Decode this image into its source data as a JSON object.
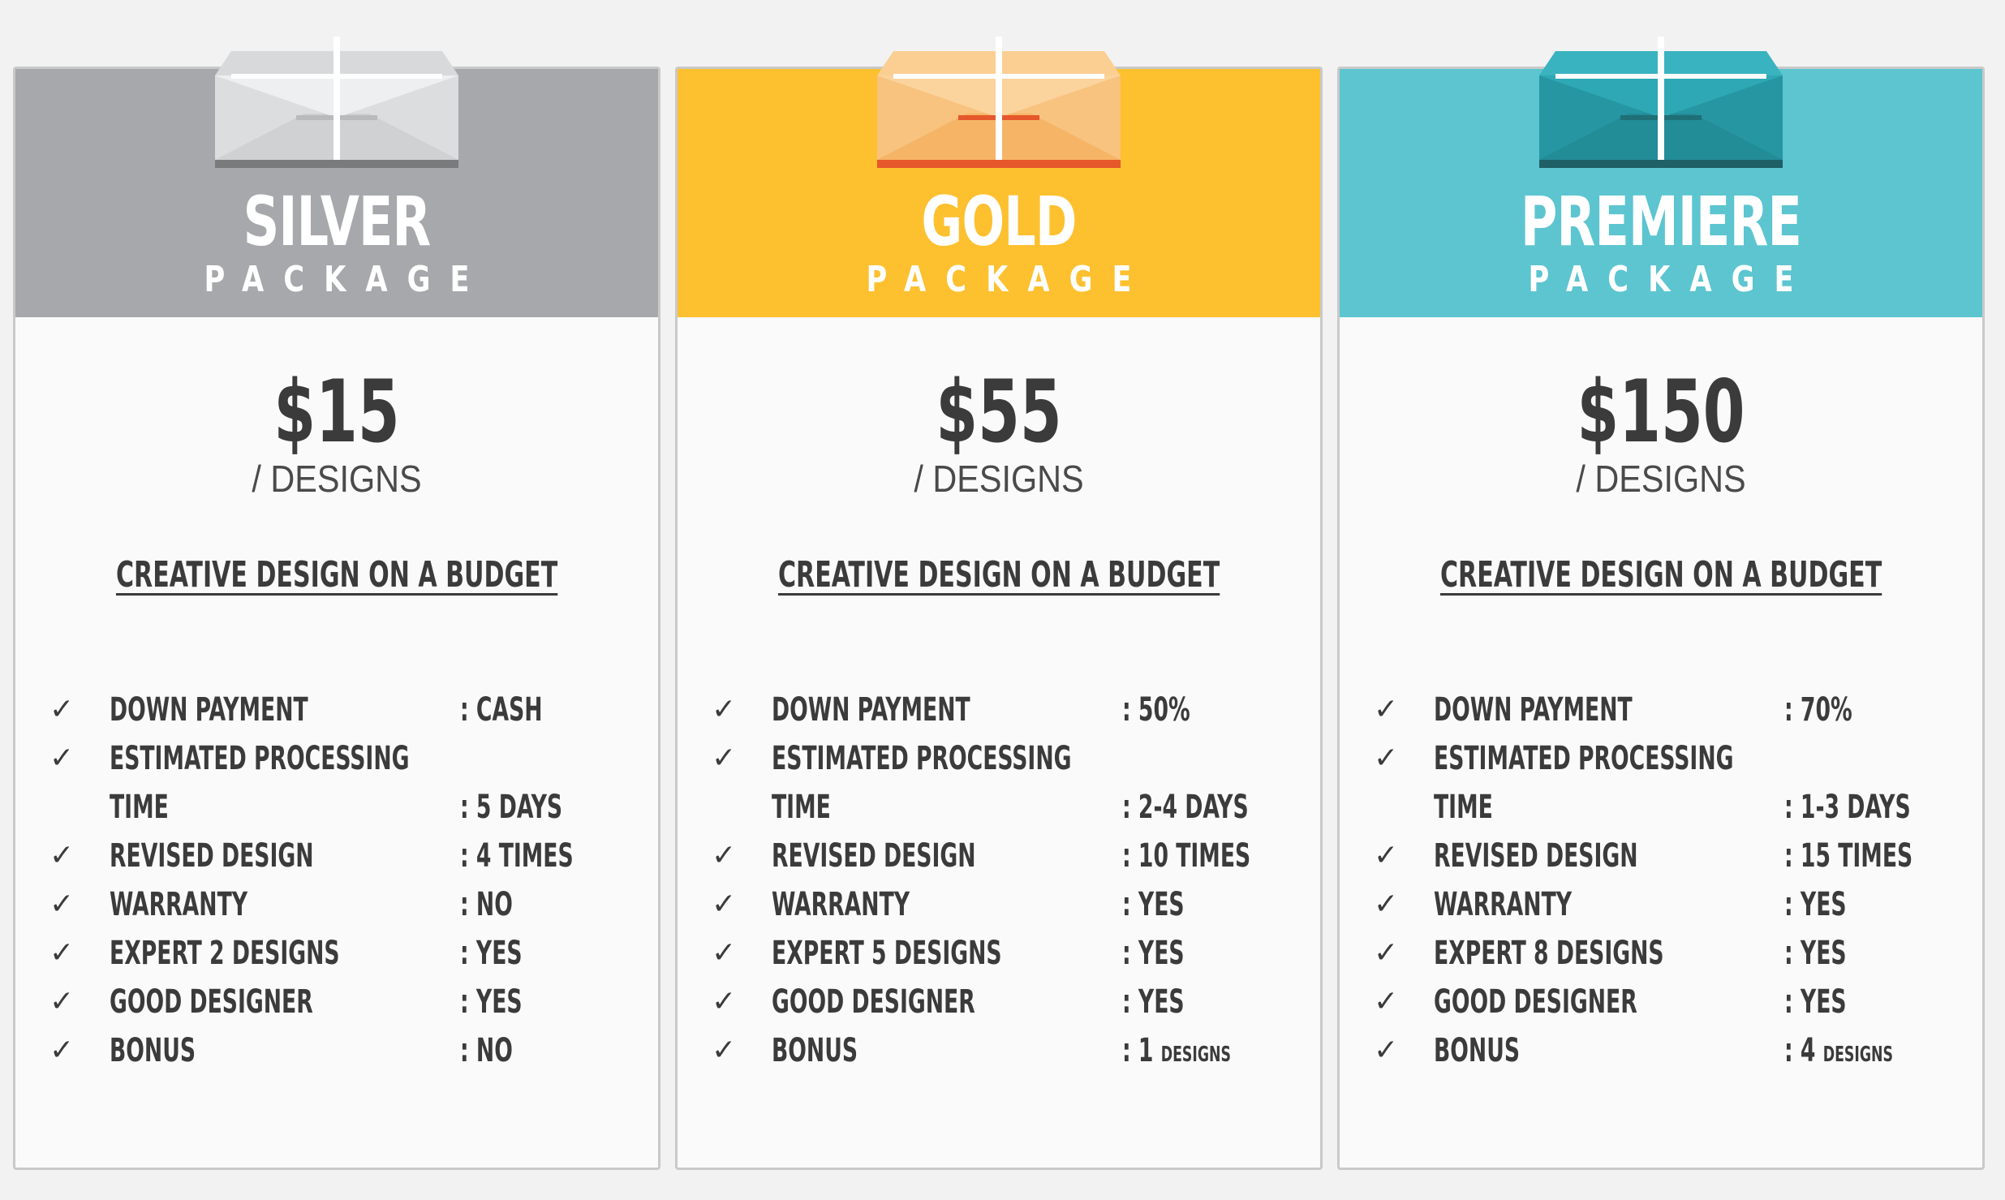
{
  "packages": [
    {
      "name": "SILVER",
      "subtitle": "PACKAGE",
      "price": "$15",
      "unit": "/ DESIGNS",
      "tagline": "CREATIVE DESIGN ON A BUDGET",
      "header_color": "#a7a8ab",
      "features": [
        {
          "label": "DOWN PAYMENT",
          "value": ": CASH",
          "check": "✓"
        },
        {
          "label": "ESTIMATED PROCESSING",
          "value": "",
          "check": "✓"
        },
        {
          "label": "TIME",
          "value": ": 5 DAYS",
          "check": ""
        },
        {
          "label": "REVISED DESIGN",
          "value": ": 4 TIMES",
          "check": "✓"
        },
        {
          "label": "WARRANTY",
          "value": ": NO",
          "check": "✓"
        },
        {
          "label": "EXPERT 2 DESIGNS",
          "value": ": YES",
          "check": "✓"
        },
        {
          "label": "GOOD DESIGNER",
          "value": ": YES",
          "check": "✓"
        },
        {
          "label": "BONUS",
          "value": ": NO",
          "check": "✓"
        }
      ]
    },
    {
      "name": "GOLD",
      "subtitle": "PACKAGE",
      "price": "$55",
      "unit": "/ DESIGNS",
      "tagline": "CREATIVE DESIGN ON A BUDGET",
      "header_color": "#fdc02f",
      "features": [
        {
          "label": "DOWN PAYMENT",
          "value": ": 50%",
          "check": "✓"
        },
        {
          "label": "ESTIMATED PROCESSING",
          "value": "",
          "check": "✓"
        },
        {
          "label": "TIME",
          "value": ": 2-4 DAYS",
          "check": ""
        },
        {
          "label": "REVISED DESIGN",
          "value": ": 10 TIMES",
          "check": "✓"
        },
        {
          "label": "WARRANTY",
          "value": ": YES",
          "check": "✓"
        },
        {
          "label": "EXPERT 5 DESIGNS",
          "value": ": YES",
          "check": "✓"
        },
        {
          "label": "GOOD DESIGNER",
          "value": ": YES",
          "check": "✓"
        },
        {
          "label": "BONUS",
          "value": ": 1",
          "suffix": "DESIGNS",
          "check": "✓"
        }
      ]
    },
    {
      "name": "PREMIERE",
      "subtitle": "PACKAGE",
      "price": "$150",
      "unit": "/ DESIGNS",
      "tagline": "CREATIVE DESIGN ON A BUDGET",
      "header_color": "#5cc5d0",
      "features": [
        {
          "label": "DOWN PAYMENT",
          "value": ": 70%",
          "check": "✓"
        },
        {
          "label": "ESTIMATED PROCESSING",
          "value": "",
          "check": "✓"
        },
        {
          "label": "TIME",
          "value": ": 1-3 DAYS",
          "check": ""
        },
        {
          "label": "REVISED DESIGN",
          "value": ": 15 TIMES",
          "check": "✓"
        },
        {
          "label": "WARRANTY",
          "value": ": YES",
          "check": "✓"
        },
        {
          "label": "EXPERT 8 DESIGNS",
          "value": ": YES",
          "check": "✓"
        },
        {
          "label": "GOOD DESIGNER",
          "value": ": YES",
          "check": "✓"
        },
        {
          "label": "BONUS",
          "value": ": 4",
          "suffix": "DESIGNS",
          "check": "✓"
        }
      ]
    }
  ],
  "icons": {
    "envelope": "envelope-icon",
    "check": "check-icon"
  },
  "colors": {
    "silver_envelope": [
      "#d8d9db",
      "#e8e9ea",
      "#b9babc",
      "#7a7b7d"
    ],
    "gold_envelope": [
      "#f6b566",
      "#fbcf92",
      "#f0a351",
      "#e6572c"
    ],
    "premiere_envelope": [
      "#2a9fab",
      "#39b3bf",
      "#228c97",
      "#1f5f66"
    ]
  }
}
